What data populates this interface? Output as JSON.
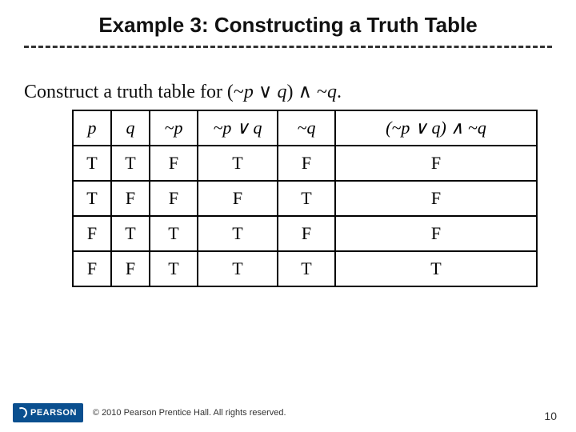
{
  "title": "Example 3: Constructing a Truth Table",
  "instruction": {
    "prefix": "Construct a truth table for (~",
    "p": "p",
    "mid1": " ∨ ",
    "q": "q",
    "mid2": ") ∧ ~",
    "q2": "q",
    "suffix": "."
  },
  "chart_data": {
    "type": "table",
    "title": "Truth table for (~p ∨ q) ∧ ~q",
    "columns": [
      "p",
      "q",
      "~p",
      "~p ∨ q",
      "~q",
      "(~p ∨ q) ∧ ~q"
    ],
    "rows": [
      [
        "T",
        "T",
        "F",
        "T",
        "F",
        "F"
      ],
      [
        "T",
        "F",
        "F",
        "F",
        "T",
        "F"
      ],
      [
        "F",
        "T",
        "T",
        "T",
        "F",
        "F"
      ],
      [
        "F",
        "F",
        "T",
        "T",
        "T",
        "T"
      ]
    ]
  },
  "footer": {
    "brand": "PEARSON",
    "copyright": "© 2010 Pearson Prentice Hall. All rights reserved.",
    "page": "10"
  }
}
